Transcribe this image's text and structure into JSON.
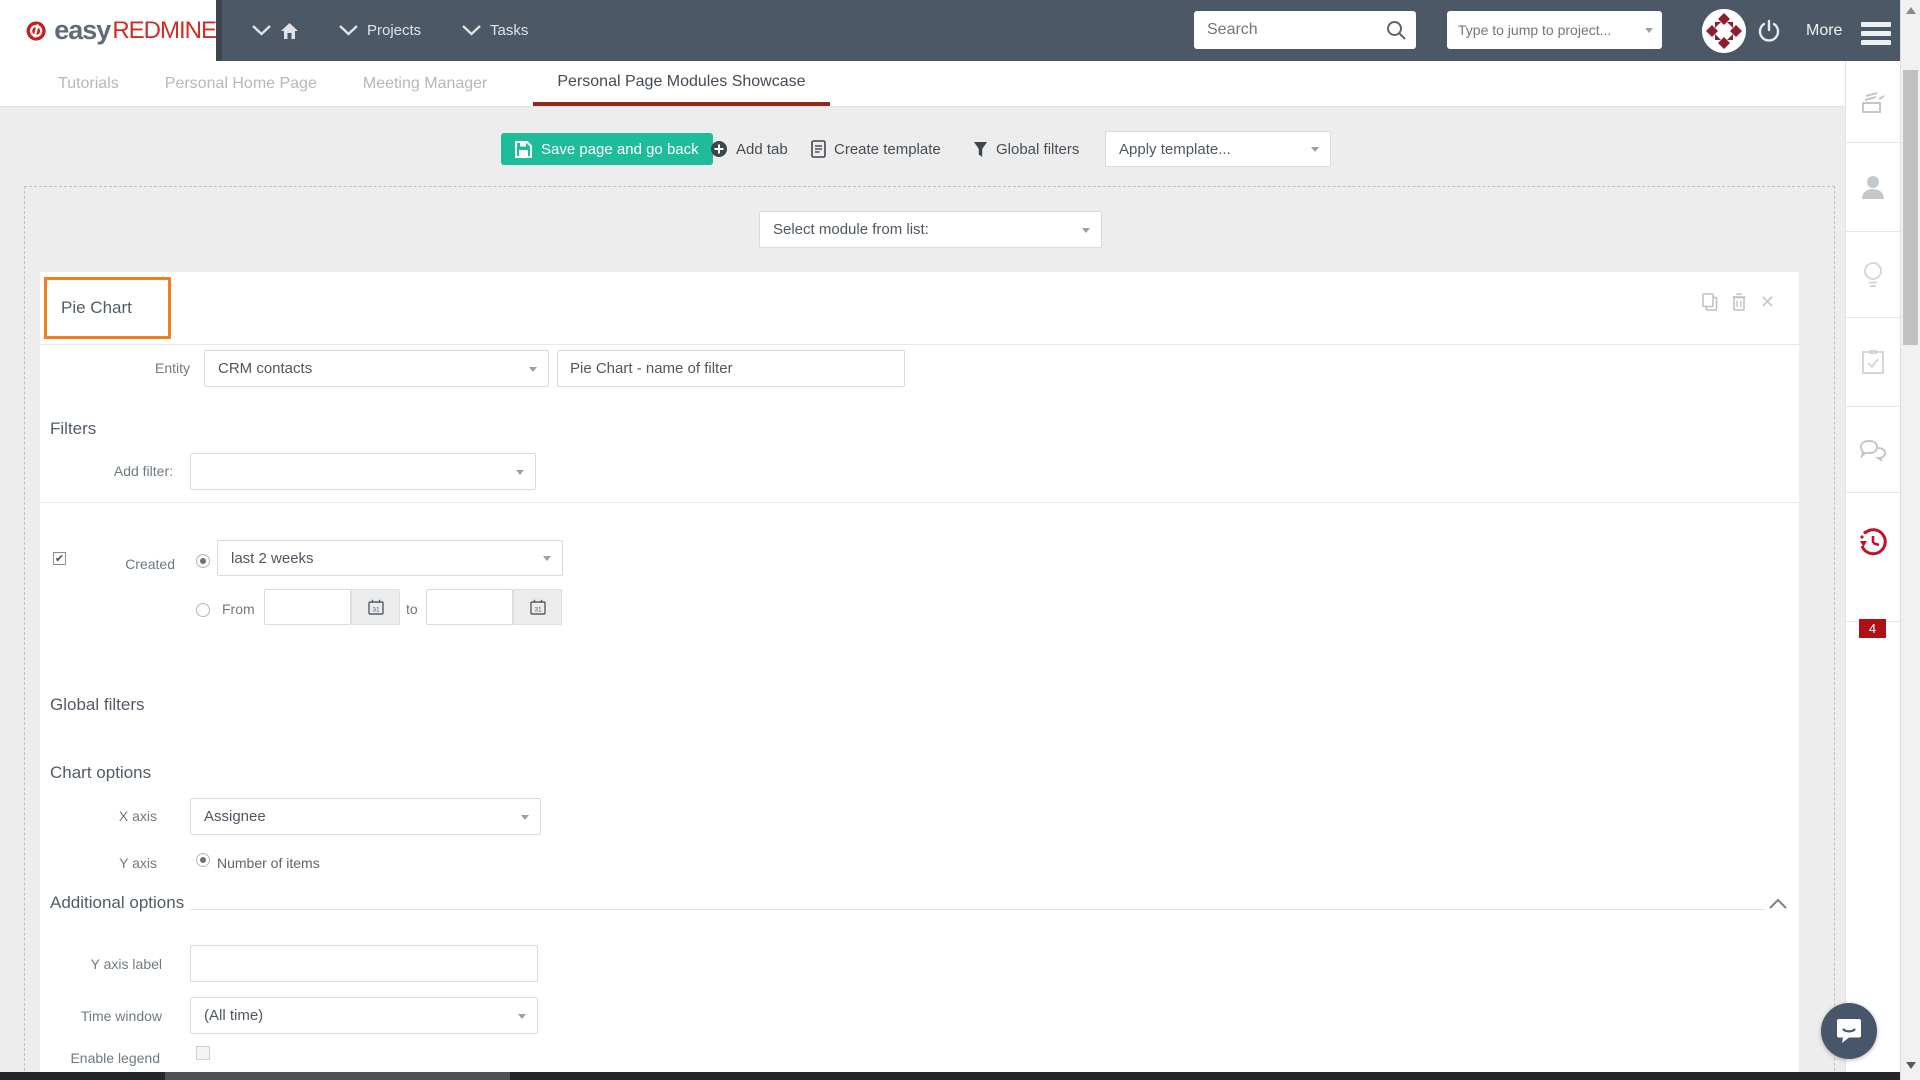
{
  "topbar": {
    "brand": {
      "easy": "easy",
      "redmine": "REDMINE"
    },
    "nav": [
      {
        "label": "Projects"
      },
      {
        "label": "Tasks"
      }
    ],
    "search": {
      "placeholder": "Search"
    },
    "jump": {
      "placeholder": "Type to jump to project..."
    },
    "more_label": "More"
  },
  "tabs": [
    {
      "label": "Tutorials"
    },
    {
      "label": "Personal Home Page"
    },
    {
      "label": "Meeting Manager"
    },
    {
      "label": "Personal Page Modules Showcase"
    }
  ],
  "toolbar": {
    "save_label": "Save page and go back",
    "add_tab_label": "Add tab",
    "create_template_label": "Create template",
    "global_filters_label": "Global filters",
    "apply_template_value": "Apply template..."
  },
  "module_select": {
    "value": "Select module from list:"
  },
  "panel": {
    "title": "Pie Chart",
    "entity": {
      "label": "Entity",
      "value": "CRM contacts",
      "filter_name": "Pie Chart - name of filter"
    },
    "filters": {
      "heading": "Filters",
      "add_filter_label": "Add filter:",
      "created": {
        "label": "Created",
        "option": "last 2 weeks",
        "from_label": "From",
        "to_label": "to"
      }
    },
    "global_filters_heading": "Global filters",
    "chart_options": {
      "heading": "Chart options",
      "x_axis_label": "X axis",
      "x_axis_value": "Assignee",
      "y_axis_label": "Y axis",
      "y_axis_value": "Number of items"
    },
    "additional": {
      "heading": "Additional options",
      "y_axis_label_label": "Y axis label",
      "time_window_label": "Time window",
      "time_window_value": "(All time)",
      "enable_legend_label": "Enable legend"
    }
  },
  "sidebar": {
    "icons": [
      "news-icon",
      "user-icon",
      "bulb-icon",
      "tasks-icon",
      "chat-icon",
      "history-icon"
    ],
    "history_badge": "4"
  },
  "colors": {
    "topbar_bg": "#4d5866",
    "accent_teal": "#1fbc9c",
    "brand_red": "#cf2e27",
    "tab_underline": "#93291e",
    "highlight_orange": "#ef8122",
    "badge_red": "#ad1116"
  }
}
